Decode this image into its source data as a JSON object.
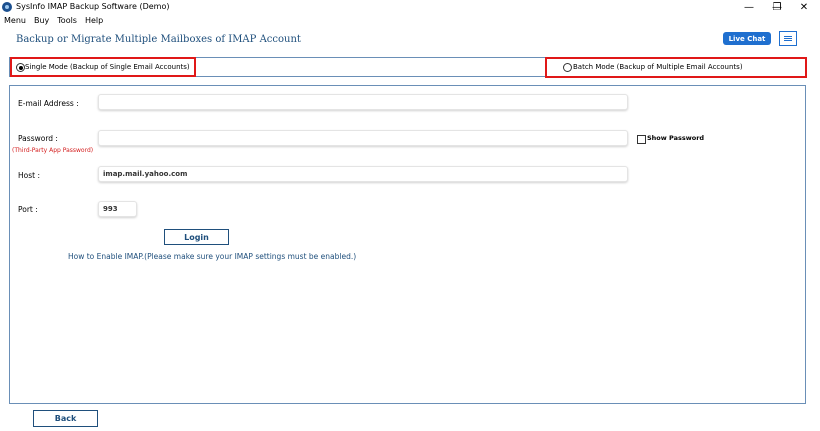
{
  "window": {
    "title": "SysInfo IMAP Backup Software (Demo)",
    "minimize_glyph": "—",
    "restore_glyph": "❐",
    "close_glyph": "✕"
  },
  "menu": [
    "Menu",
    "Buy",
    "Tools",
    "Help"
  ],
  "header": {
    "title": "Backup or Migrate Multiple Mailboxes of IMAP Account",
    "live_chat": "Live Chat"
  },
  "modes": {
    "single": {
      "label": "Single Mode (Backup of Single Email Accounts)",
      "selected": true
    },
    "batch": {
      "label": "Batch Mode (Backup of Multiple Email Accounts)",
      "selected": false
    }
  },
  "form": {
    "email_label": "E-mail Address :",
    "email_value": "",
    "password_label": "Password :",
    "password_note": "(Third-Party App Password)",
    "password_value": "",
    "show_password_label": "Show Password",
    "host_label": "Host :",
    "host_value": "imap.mail.yahoo.com",
    "port_label": "Port :",
    "port_value": "993",
    "login_label": "Login",
    "imap_help": "How to Enable IMAP.(Please make sure your IMAP settings must be enabled.)"
  },
  "footer": {
    "back_label": "Back"
  },
  "colors": {
    "accent": "#1f6fcf",
    "heading": "#1f4f7c",
    "highlight_border": "#e01818",
    "panel_border": "#6a8fb7",
    "note_red": "#d42020"
  }
}
